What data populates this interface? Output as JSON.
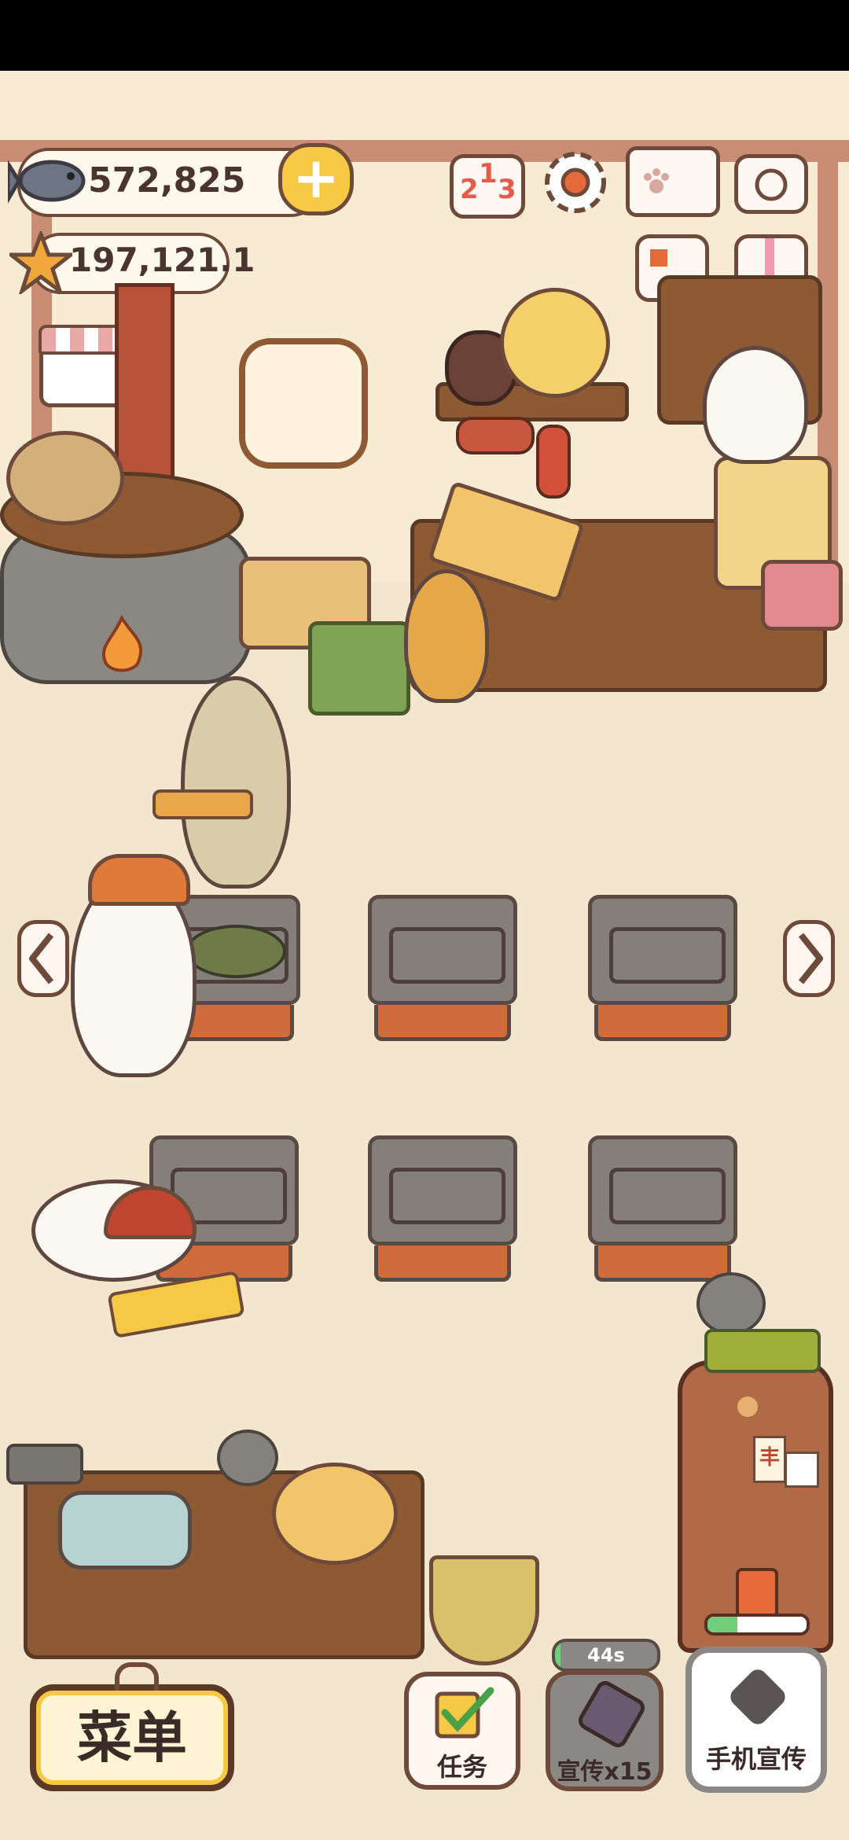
{
  "currency": {
    "fish_amount": "572,825",
    "star_amount": "197,121.1",
    "add_symbol": "+"
  },
  "toolbar": {
    "ranking_digits": [
      "2",
      "1",
      "3"
    ]
  },
  "timer": {
    "label": "44s",
    "fill_fraction": 0.05
  },
  "buttons": {
    "menu": "菜单",
    "tasks": "任务",
    "promo": "宣传x15",
    "phone_promo": "手机宣传"
  },
  "fridge": {
    "note_char": "丰",
    "progress_fraction": 0.3
  },
  "colors": {
    "accent_yellow": "#f7c843",
    "wood": "#8e5a33",
    "outline": "#6e4a3a",
    "progress_green": "#6fcf7a"
  }
}
